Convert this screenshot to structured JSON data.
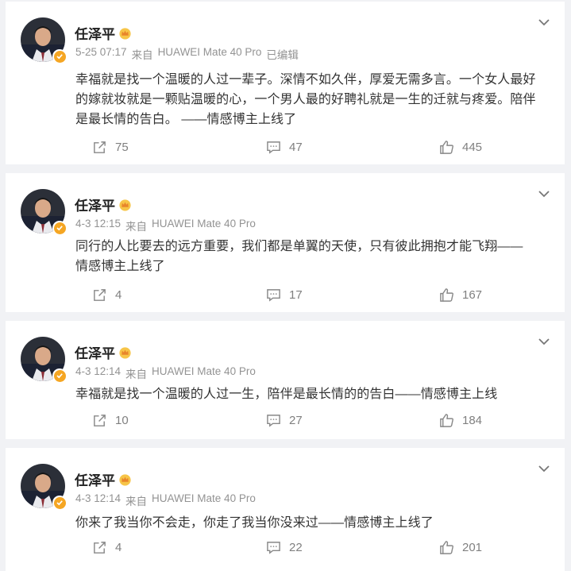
{
  "colors": {
    "page_bg": "#f1f2f5",
    "card_bg": "#ffffff",
    "name": "#222222",
    "meta": "#939393",
    "body_text": "#333333",
    "action_text": "#808080",
    "verified_badge": "#f5a623"
  },
  "icons": {
    "repost": "repost-icon",
    "comment": "comment-icon",
    "like": "like-icon",
    "menu": "chevron-down-icon",
    "crown": "crown-icon",
    "verified": "verified-badge-icon"
  },
  "posts": [
    {
      "author": "任泽平",
      "date": "5-25 07:17",
      "source_prefix": "来自",
      "device": "HUAWEI Mate 40 Pro",
      "edited": "已编辑",
      "lines": [
        "幸福就是找一个温暖的人过一辈子。深情不如久伴，厚爱无需多言。一个女人最好",
        "的嫁就妆就是一颗贴温暖的心，一个男人最的好聘礼就是一生的迁就与疼爱。陪伴",
        "是最长情的告白。 ——情感博主上线了"
      ],
      "reposts": "75",
      "comments": "47",
      "likes": "445"
    },
    {
      "author": "任泽平",
      "date": "4-3 12:15",
      "source_prefix": "来自",
      "device": "HUAWEI Mate 40 Pro",
      "edited": "",
      "lines": [
        "同行的人比要去的远方重要，我们都是单翼的天使，只有彼此拥抱才能飞翔——",
        "情感博主上线了"
      ],
      "reposts": "4",
      "comments": "17",
      "likes": "167"
    },
    {
      "author": "任泽平",
      "date": "4-3 12:14",
      "source_prefix": "来自",
      "device": "HUAWEI Mate 40 Pro",
      "edited": "",
      "lines": [
        "幸福就是找一个温暖的人过一生，陪伴是最长情的的告白——情感博主上线"
      ],
      "reposts": "10",
      "comments": "27",
      "likes": "184"
    },
    {
      "author": "任泽平",
      "date": "4-3 12:14",
      "source_prefix": "来自",
      "device": "HUAWEI Mate 40 Pro",
      "edited": "",
      "lines": [
        "你来了我当你不会走，你走了我当你没来过——情感博主上线了"
      ],
      "reposts": "4",
      "comments": "22",
      "likes": "201"
    }
  ]
}
